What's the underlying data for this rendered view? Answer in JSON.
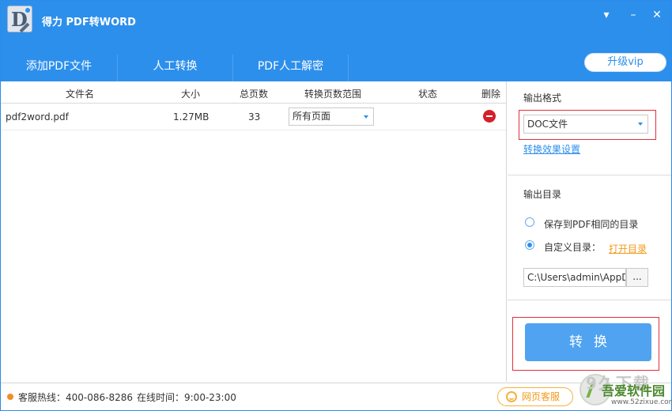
{
  "app": {
    "title": "得力 PDF转WORD",
    "logo_letter": "D"
  },
  "window_controls": {
    "menu": "▾",
    "minimize": "–",
    "close": "✕"
  },
  "toolbar": {
    "tabs": [
      {
        "label": "添加PDF文件"
      },
      {
        "label": "人工转换"
      },
      {
        "label": "PDF人工解密"
      }
    ],
    "upgrade_label": "升级vip"
  },
  "table": {
    "headers": {
      "filename": "文件名",
      "size": "大小",
      "pages": "总页数",
      "range": "转换页数范围",
      "status": "状态",
      "delete": "删除"
    },
    "rows": [
      {
        "filename": "pdf2word.pdf",
        "size": "1.27MB",
        "pages": "33",
        "range": "所有页面",
        "status": ""
      }
    ]
  },
  "output_format": {
    "title": "输出格式",
    "selected": "DOC文件",
    "settings_link": "转换效果设置"
  },
  "output_dir": {
    "title": "输出目录",
    "option_same": "保存到PDF相同的目录",
    "option_custom": "自定义目录：",
    "open_link": "打开目录",
    "path_value": "C:\\Users\\admin\\AppData",
    "browse_label": "..."
  },
  "convert_label": "转换",
  "status_bar": {
    "hotline": "客服热线：400-086-8286",
    "online_time": "在线时间：9:00-23:00",
    "service_label": "网页客服"
  },
  "watermark": {
    "text": "9久下载",
    "site_name": "吾爱软件园",
    "url": "www.52zixue.com"
  },
  "colors": {
    "accent": "#2d8fec",
    "convert_button": "#4fa3f0",
    "highlight_box": "#e0303a",
    "service": "#f29a1a"
  }
}
